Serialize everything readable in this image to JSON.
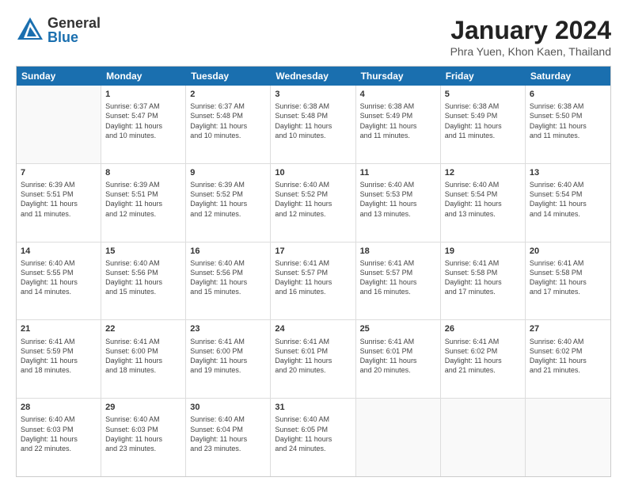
{
  "logo": {
    "general": "General",
    "blue": "Blue"
  },
  "title": "January 2024",
  "subtitle": "Phra Yuen, Khon Kaen, Thailand",
  "header_days": [
    "Sunday",
    "Monday",
    "Tuesday",
    "Wednesday",
    "Thursday",
    "Friday",
    "Saturday"
  ],
  "rows": [
    [
      {
        "day": "",
        "info": "",
        "empty": true
      },
      {
        "day": "1",
        "info": "Sunrise: 6:37 AM\nSunset: 5:47 PM\nDaylight: 11 hours\nand 10 minutes.",
        "empty": false
      },
      {
        "day": "2",
        "info": "Sunrise: 6:37 AM\nSunset: 5:48 PM\nDaylight: 11 hours\nand 10 minutes.",
        "empty": false
      },
      {
        "day": "3",
        "info": "Sunrise: 6:38 AM\nSunset: 5:48 PM\nDaylight: 11 hours\nand 10 minutes.",
        "empty": false
      },
      {
        "day": "4",
        "info": "Sunrise: 6:38 AM\nSunset: 5:49 PM\nDaylight: 11 hours\nand 11 minutes.",
        "empty": false
      },
      {
        "day": "5",
        "info": "Sunrise: 6:38 AM\nSunset: 5:49 PM\nDaylight: 11 hours\nand 11 minutes.",
        "empty": false
      },
      {
        "day": "6",
        "info": "Sunrise: 6:38 AM\nSunset: 5:50 PM\nDaylight: 11 hours\nand 11 minutes.",
        "empty": false
      }
    ],
    [
      {
        "day": "7",
        "info": "Sunrise: 6:39 AM\nSunset: 5:51 PM\nDaylight: 11 hours\nand 11 minutes.",
        "empty": false
      },
      {
        "day": "8",
        "info": "Sunrise: 6:39 AM\nSunset: 5:51 PM\nDaylight: 11 hours\nand 12 minutes.",
        "empty": false
      },
      {
        "day": "9",
        "info": "Sunrise: 6:39 AM\nSunset: 5:52 PM\nDaylight: 11 hours\nand 12 minutes.",
        "empty": false
      },
      {
        "day": "10",
        "info": "Sunrise: 6:40 AM\nSunset: 5:52 PM\nDaylight: 11 hours\nand 12 minutes.",
        "empty": false
      },
      {
        "day": "11",
        "info": "Sunrise: 6:40 AM\nSunset: 5:53 PM\nDaylight: 11 hours\nand 13 minutes.",
        "empty": false
      },
      {
        "day": "12",
        "info": "Sunrise: 6:40 AM\nSunset: 5:54 PM\nDaylight: 11 hours\nand 13 minutes.",
        "empty": false
      },
      {
        "day": "13",
        "info": "Sunrise: 6:40 AM\nSunset: 5:54 PM\nDaylight: 11 hours\nand 14 minutes.",
        "empty": false
      }
    ],
    [
      {
        "day": "14",
        "info": "Sunrise: 6:40 AM\nSunset: 5:55 PM\nDaylight: 11 hours\nand 14 minutes.",
        "empty": false
      },
      {
        "day": "15",
        "info": "Sunrise: 6:40 AM\nSunset: 5:56 PM\nDaylight: 11 hours\nand 15 minutes.",
        "empty": false
      },
      {
        "day": "16",
        "info": "Sunrise: 6:40 AM\nSunset: 5:56 PM\nDaylight: 11 hours\nand 15 minutes.",
        "empty": false
      },
      {
        "day": "17",
        "info": "Sunrise: 6:41 AM\nSunset: 5:57 PM\nDaylight: 11 hours\nand 16 minutes.",
        "empty": false
      },
      {
        "day": "18",
        "info": "Sunrise: 6:41 AM\nSunset: 5:57 PM\nDaylight: 11 hours\nand 16 minutes.",
        "empty": false
      },
      {
        "day": "19",
        "info": "Sunrise: 6:41 AM\nSunset: 5:58 PM\nDaylight: 11 hours\nand 17 minutes.",
        "empty": false
      },
      {
        "day": "20",
        "info": "Sunrise: 6:41 AM\nSunset: 5:58 PM\nDaylight: 11 hours\nand 17 minutes.",
        "empty": false
      }
    ],
    [
      {
        "day": "21",
        "info": "Sunrise: 6:41 AM\nSunset: 5:59 PM\nDaylight: 11 hours\nand 18 minutes.",
        "empty": false
      },
      {
        "day": "22",
        "info": "Sunrise: 6:41 AM\nSunset: 6:00 PM\nDaylight: 11 hours\nand 18 minutes.",
        "empty": false
      },
      {
        "day": "23",
        "info": "Sunrise: 6:41 AM\nSunset: 6:00 PM\nDaylight: 11 hours\nand 19 minutes.",
        "empty": false
      },
      {
        "day": "24",
        "info": "Sunrise: 6:41 AM\nSunset: 6:01 PM\nDaylight: 11 hours\nand 20 minutes.",
        "empty": false
      },
      {
        "day": "25",
        "info": "Sunrise: 6:41 AM\nSunset: 6:01 PM\nDaylight: 11 hours\nand 20 minutes.",
        "empty": false
      },
      {
        "day": "26",
        "info": "Sunrise: 6:41 AM\nSunset: 6:02 PM\nDaylight: 11 hours\nand 21 minutes.",
        "empty": false
      },
      {
        "day": "27",
        "info": "Sunrise: 6:40 AM\nSunset: 6:02 PM\nDaylight: 11 hours\nand 21 minutes.",
        "empty": false
      }
    ],
    [
      {
        "day": "28",
        "info": "Sunrise: 6:40 AM\nSunset: 6:03 PM\nDaylight: 11 hours\nand 22 minutes.",
        "empty": false
      },
      {
        "day": "29",
        "info": "Sunrise: 6:40 AM\nSunset: 6:03 PM\nDaylight: 11 hours\nand 23 minutes.",
        "empty": false
      },
      {
        "day": "30",
        "info": "Sunrise: 6:40 AM\nSunset: 6:04 PM\nDaylight: 11 hours\nand 23 minutes.",
        "empty": false
      },
      {
        "day": "31",
        "info": "Sunrise: 6:40 AM\nSunset: 6:05 PM\nDaylight: 11 hours\nand 24 minutes.",
        "empty": false
      },
      {
        "day": "",
        "info": "",
        "empty": true
      },
      {
        "day": "",
        "info": "",
        "empty": true
      },
      {
        "day": "",
        "info": "",
        "empty": true
      }
    ]
  ]
}
